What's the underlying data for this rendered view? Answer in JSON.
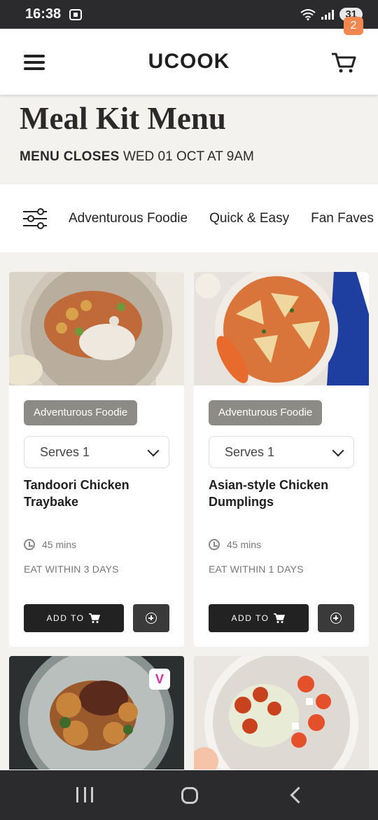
{
  "status_bar": {
    "time": "16:38",
    "battery": "31"
  },
  "header": {
    "logo": "UCOOK",
    "cart_count": "2"
  },
  "page": {
    "title": "Meal Kit Menu",
    "menu_closes_label": "MENU CLOSES",
    "menu_closes_value": "WED 01 OCT AT 9AM"
  },
  "filters": [
    "Adventurous Foodie",
    "Quick & Easy",
    "Fan Faves"
  ],
  "meals": [
    {
      "tag": "Adventurous Foodie",
      "serves": "Serves 1",
      "title": "Tandoori Chicken Traybake",
      "time": "45 mins",
      "eat_within": "EAT WITHIN 3 DAYS",
      "add_label": "ADD TO"
    },
    {
      "tag": "Adventurous Foodie",
      "serves": "Serves 1",
      "title": "Asian-style Chicken Dumplings",
      "time": "45 mins",
      "eat_within": "EAT WITHIN 1 DAYS",
      "add_label": "ADD TO"
    }
  ],
  "colors": {
    "accent": "#f2874f",
    "dark": "#222222",
    "tag": "#8c8b85",
    "veg": "#d62da2"
  },
  "icons": [
    "menu-icon",
    "cart-icon",
    "filter-icon",
    "clock-icon",
    "plus-circle-icon",
    "vegetarian-icon"
  ]
}
